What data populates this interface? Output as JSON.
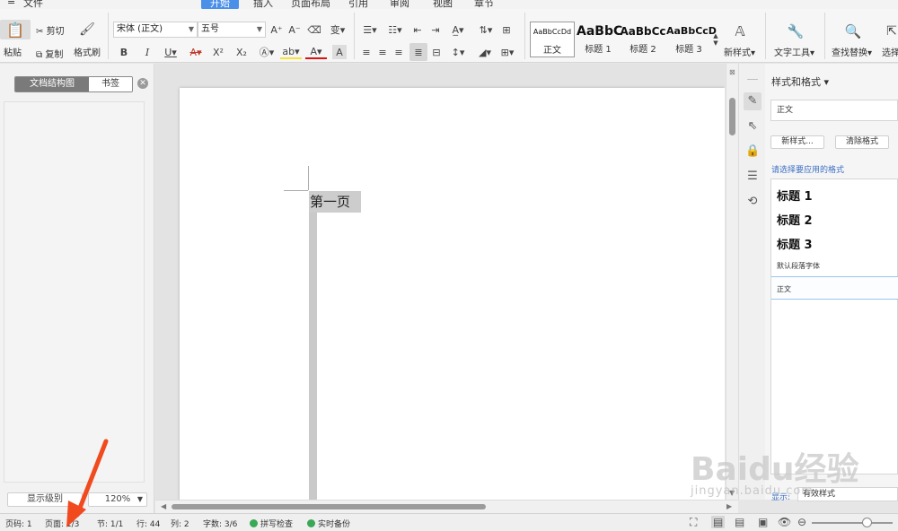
{
  "menu": {
    "file": "文件",
    "tabs": [
      "开始",
      "插入",
      "页面布局",
      "引用",
      "审阅",
      "视图",
      "章节"
    ],
    "active_tab": "开始"
  },
  "ribbon": {
    "paste": "粘贴",
    "cut": "剪切",
    "copy": "复制",
    "format_painter": "格式刷",
    "font_name": "宋体 (正文)",
    "font_size": "五号",
    "bold": "B",
    "italic": "I",
    "underline": "U",
    "font_color_a": "A",
    "superscript": "X²",
    "subscript": "X₂",
    "styles": [
      {
        "preview": "AaBbCcDd",
        "name": "正文"
      },
      {
        "preview": "AaBbC",
        "name": "标题 1"
      },
      {
        "preview": "AaBbCc",
        "name": "标题 2"
      },
      {
        "preview": "AaBbCcD",
        "name": "标题 3"
      }
    ],
    "new_style": "新样式",
    "text_tools": "文字工具",
    "find_replace": "查找替换",
    "select": "选择"
  },
  "left_pane": {
    "tab_structure": "文档结构图",
    "tab_bookmarks": "书签",
    "show_level": "显示级别",
    "zoom": "120%"
  },
  "document": {
    "text": "第一页"
  },
  "style_panel": {
    "title": "样式和格式",
    "current": "正文",
    "new_style_btn": "新样式...",
    "clear_format_btn": "清除格式",
    "hint": "请选择要应用的格式",
    "items": {
      "h1": "标题 1",
      "h2": "标题 2",
      "h3": "标题 3",
      "default_font": "默认段落字体",
      "normal": "正文"
    },
    "show_label": "显示:",
    "show_value": "有效样式"
  },
  "status": {
    "page_code": "页码: 1",
    "page": "页面: 1/3",
    "section": "节: 1/1",
    "row": "行: 44",
    "col": "列: 2",
    "word_count": "字数: 3/6",
    "spell_check": "拼写检查",
    "backup": "实时备份"
  },
  "watermark": {
    "brand": "Baidu经验",
    "url": "jingyan.baidu.com"
  },
  "colors": {
    "accent": "#4a8fe8",
    "annotation_arrow": "#f04a1e",
    "status_dot": "#3aa856"
  }
}
